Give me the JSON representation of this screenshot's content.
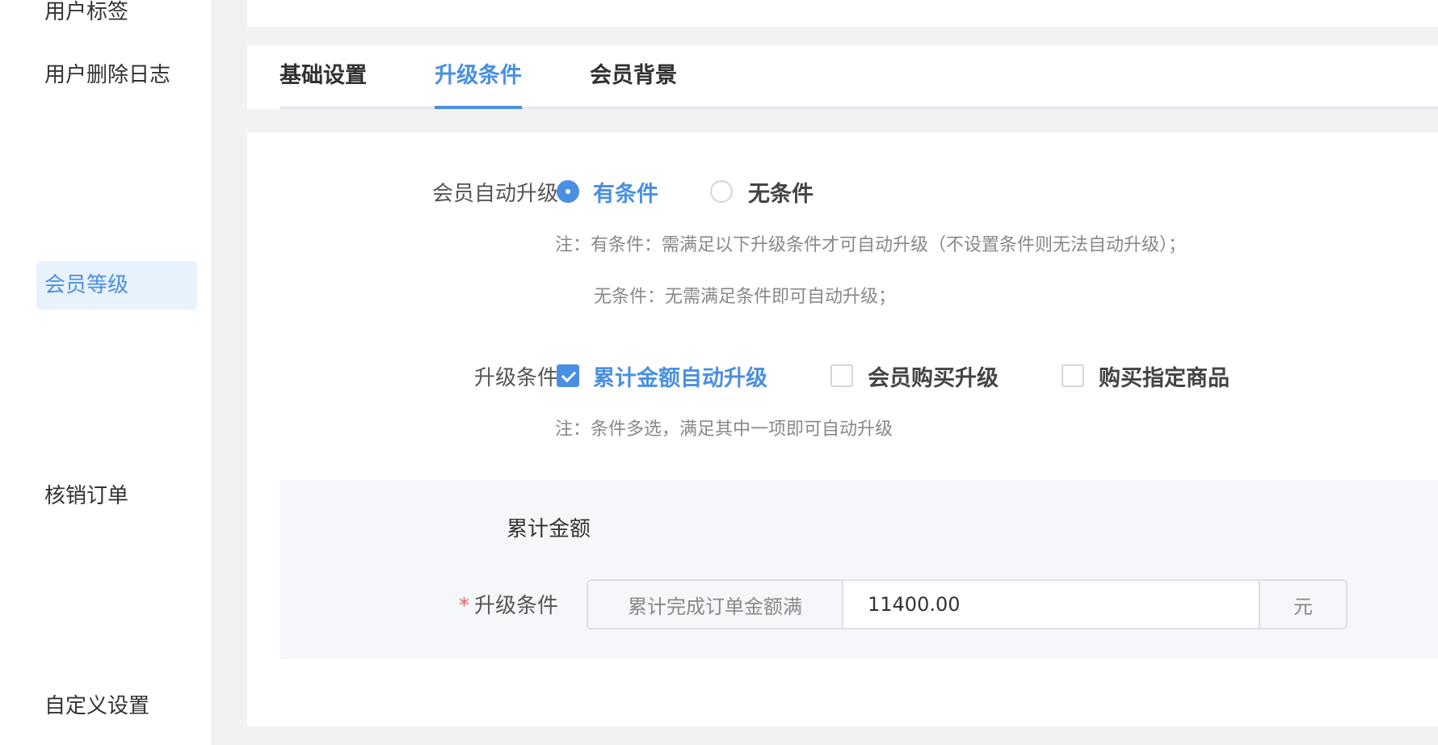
{
  "sidebar": {
    "items": [
      {
        "label": "用户标签"
      },
      {
        "label": "用户删除日志"
      },
      {
        "label": "会员等级",
        "active": true
      },
      {
        "label": "核销订单"
      },
      {
        "label": "自定义设置"
      }
    ]
  },
  "tabs": [
    {
      "label": "基础设置"
    },
    {
      "label": "升级条件",
      "active": true
    },
    {
      "label": "会员背景"
    }
  ],
  "auto_upgrade": {
    "label": "会员自动升级",
    "options": [
      {
        "label": "有条件",
        "checked": true
      },
      {
        "label": "无条件",
        "checked": false
      }
    ],
    "notes": [
      "注：有条件：需满足以下升级条件才可自动升级（不设置条件则无法自动升级）；",
      "无条件：无需满足条件即可自动升级；"
    ]
  },
  "upgrade_conditions": {
    "label": "升级条件",
    "options": [
      {
        "label": "累计金额自动升级",
        "checked": true
      },
      {
        "label": "会员购买升级",
        "checked": false
      },
      {
        "label": "购买指定商品",
        "checked": false
      }
    ],
    "note": "注：条件多选，满足其中一项即可自动升级"
  },
  "cumulative": {
    "title": "累计金额",
    "required_mark": "*",
    "field_label": "升级条件",
    "prefix": "累计完成订单金额满",
    "value": "11400.00",
    "suffix": "元"
  },
  "colors": {
    "accent": "#4a90e2",
    "required": "#e65d5d"
  }
}
